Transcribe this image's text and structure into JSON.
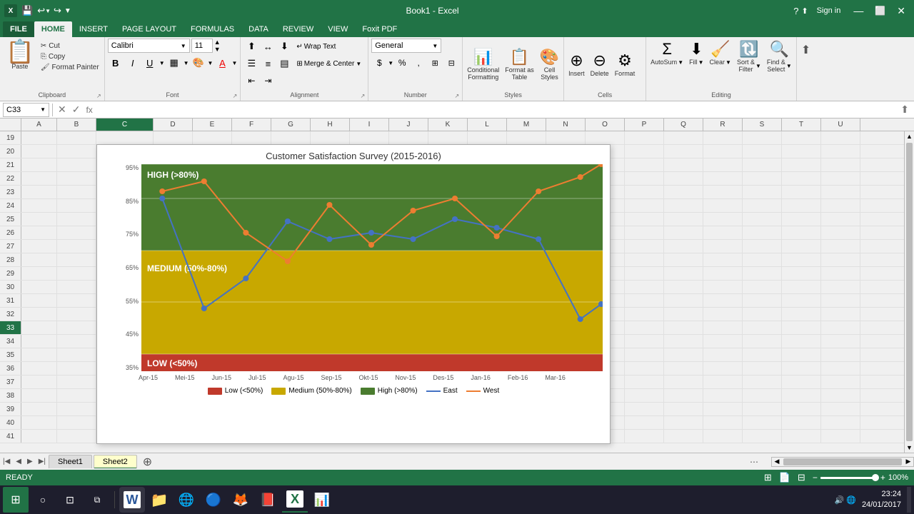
{
  "app": {
    "title": "Book1 - Excel",
    "sign_in": "Sign in"
  },
  "quick_access": {
    "buttons": [
      "💾",
      "↩",
      "↪",
      "▼"
    ]
  },
  "ribbon": {
    "tabs": [
      "FILE",
      "HOME",
      "INSERT",
      "PAGE LAYOUT",
      "FORMULAS",
      "DATA",
      "REVIEW",
      "VIEW",
      "Foxit PDF"
    ],
    "active_tab": "HOME",
    "clipboard": {
      "label": "Clipboard",
      "paste_label": "Paste",
      "cut_label": "Cut",
      "copy_label": "Copy",
      "format_painter_label": "Format Painter"
    },
    "font": {
      "label": "Font",
      "name": "Calibri",
      "size": "11",
      "bold": "B",
      "italic": "I",
      "underline": "U"
    },
    "alignment": {
      "label": "Alignment",
      "wrap_text": "Wrap Text",
      "merge_center": "Merge & Center"
    },
    "number": {
      "label": "Number",
      "format": "General"
    },
    "styles": {
      "label": "Styles",
      "conditional": "Conditional\nFormatting",
      "format_table": "Format as\nTable",
      "cell_styles": "Cell\nStyles"
    },
    "cells": {
      "label": "Cells",
      "insert": "Insert",
      "delete": "Delete",
      "format": "Format"
    },
    "editing": {
      "label": "Editing",
      "autosum": "AutoSum",
      "fill": "Fill",
      "clear": "Clear",
      "sort_filter": "Sort &\nFilter",
      "find_select": "Find &\nSelect"
    }
  },
  "formula_bar": {
    "cell_ref": "C33",
    "formula": ""
  },
  "columns": [
    "A",
    "B",
    "C",
    "D",
    "E",
    "F",
    "G",
    "H",
    "I",
    "J",
    "K",
    "L",
    "M",
    "N",
    "O",
    "P",
    "Q",
    "R",
    "S",
    "T",
    "U"
  ],
  "rows": [
    "19",
    "20",
    "21",
    "22",
    "23",
    "24",
    "25",
    "26",
    "27",
    "28",
    "29",
    "30",
    "31",
    "32",
    "33",
    "34",
    "35",
    "36",
    "37",
    "38",
    "39",
    "40",
    "41"
  ],
  "chart": {
    "title": "Customer Satisfaction Survey (2015-2016)",
    "y_labels": [
      "95%",
      "85%",
      "75%",
      "65%",
      "55%",
      "45%",
      "35%"
    ],
    "x_labels": [
      "Apr-15",
      "Mei-15",
      "Jun-15",
      "Jul-15",
      "Agu-15",
      "Sep-15",
      "Okt-15",
      "Nov-15",
      "Des-15",
      "Jan-16",
      "Feb-16",
      "Mar-16"
    ],
    "zones": {
      "high_label": "HIGH (>80%)",
      "medium_label": "MEDIUM (50%-80%)",
      "low_label": "LOW (<50%)"
    },
    "legend": {
      "low_label": "Low (<50%)",
      "medium_label": "Medium (50%-80%)",
      "high_label": "High (>80%)",
      "east_label": "East",
      "west_label": "West"
    },
    "east_data": [
      85,
      54,
      62,
      78,
      73,
      75,
      73,
      79,
      77,
      73,
      48,
      55
    ],
    "west_data": [
      88,
      90,
      75,
      67,
      83,
      72,
      81,
      84,
      74,
      88,
      92,
      95
    ]
  },
  "sheets": {
    "tabs": [
      "Sheet1",
      "Sheet2"
    ],
    "active": "Sheet2"
  },
  "status_bar": {
    "status": "READY",
    "zoom": "100%"
  },
  "taskbar": {
    "time": "23:24",
    "date": "24/01/2017"
  }
}
